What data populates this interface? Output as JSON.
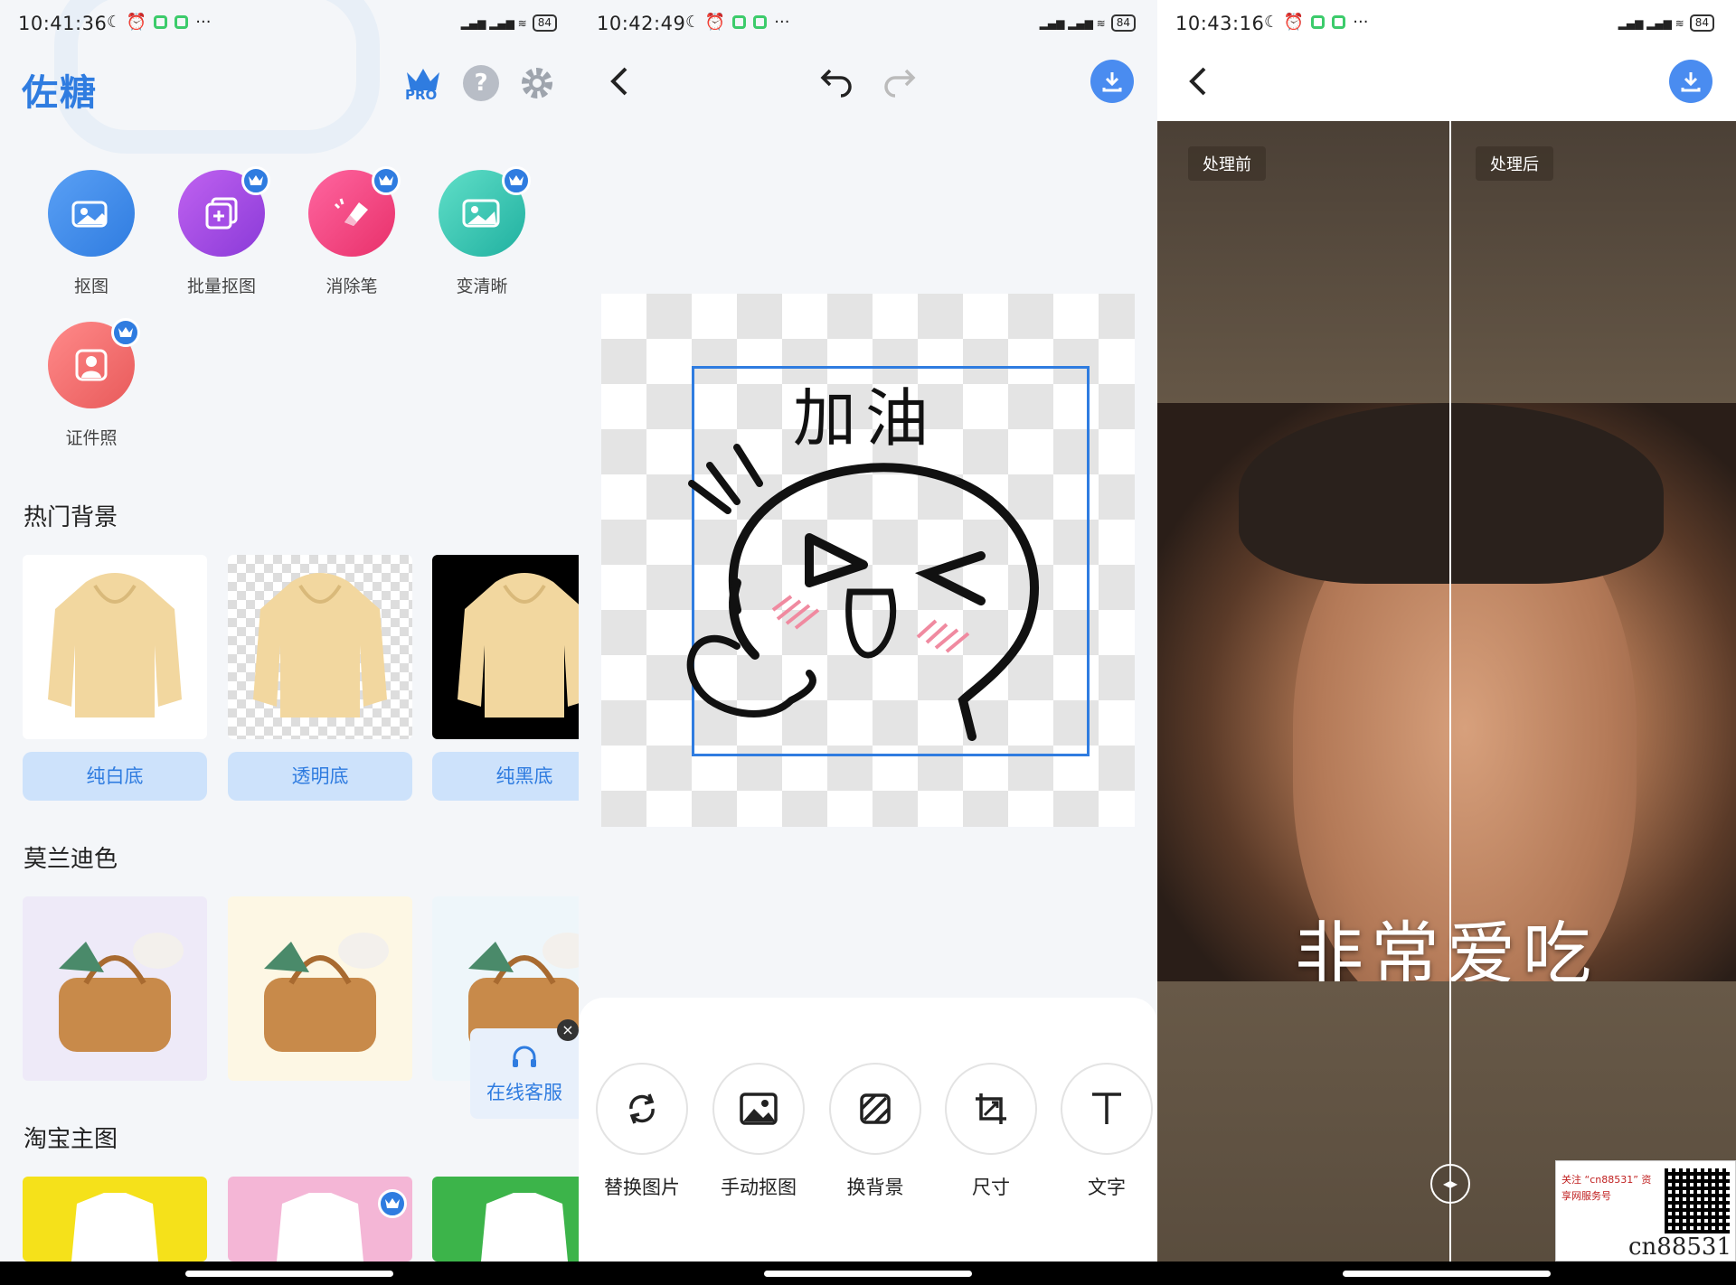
{
  "screen1": {
    "status": {
      "time": "10:41:36",
      "battery": "84"
    },
    "app_title": "佐糖",
    "pro_label": "PRO",
    "help_label": "?",
    "tools": [
      {
        "label": "抠图",
        "color": "#2f7ce0"
      },
      {
        "label": "批量抠图",
        "color": "#a54de6"
      },
      {
        "label": "消除笔",
        "color": "#f0407a"
      },
      {
        "label": "变清晰",
        "color": "#35c4b4"
      },
      {
        "label": "证件照",
        "color": "#f06a6a"
      }
    ],
    "section_hot": "热门背景",
    "hot_items": [
      "纯白底",
      "透明底",
      "纯黑底"
    ],
    "section_morandi": "莫兰迪色",
    "section_taobao": "淘宝主图",
    "service_label": "在线客服",
    "service_close": "×"
  },
  "screen2": {
    "status": {
      "time": "10:42:49",
      "battery": "84"
    },
    "sticker_text": "加油",
    "tools": [
      "替换图片",
      "手动抠图",
      "换背景",
      "尺寸",
      "文字"
    ]
  },
  "screen3": {
    "status": {
      "time": "10:43:16",
      "battery": "84"
    },
    "before_label": "处理前",
    "after_label": "处理后",
    "caption": "非常爱吃",
    "handle_glyph": "◂▸",
    "watermark_text": "关注 “cn88531” 资享网服务号",
    "watermark_id": "cn88531"
  }
}
